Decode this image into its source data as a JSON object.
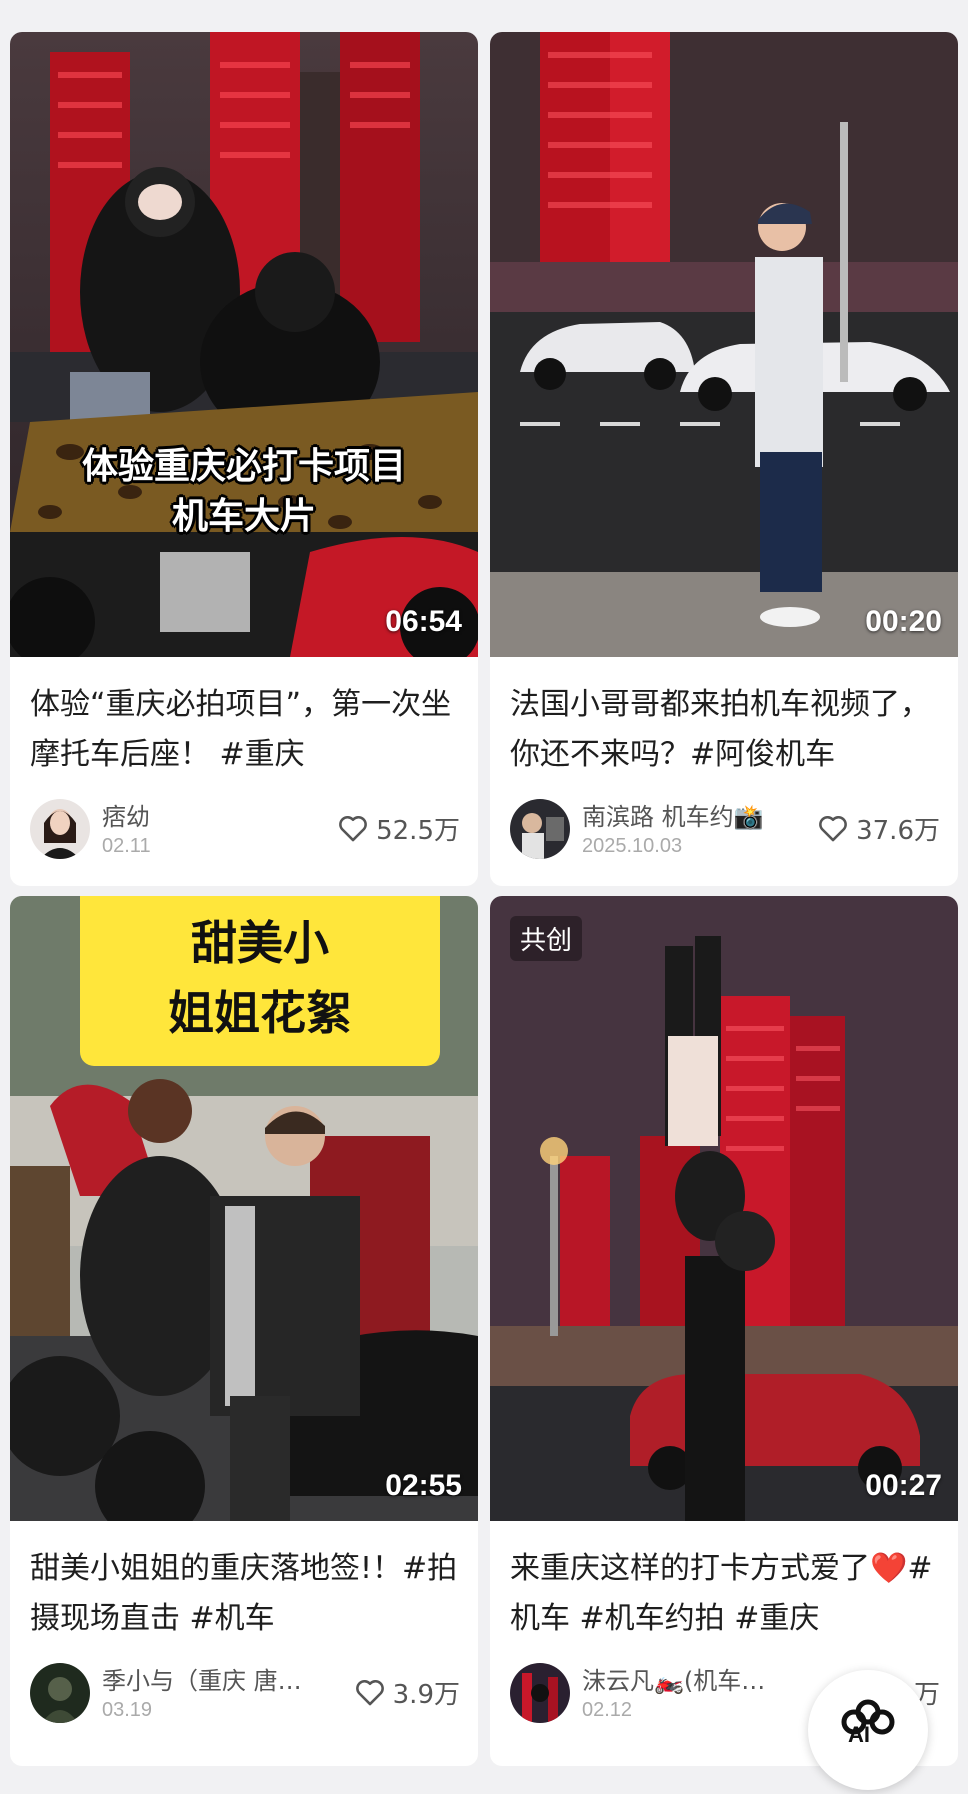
{
  "cards": [
    {
      "overlay_caption": [
        "体验重庆必打卡项目",
        "机车大片"
      ],
      "duration": "06:54",
      "title": "体验“重庆必拍项目”，第一次坐摩托车后座！ #重庆",
      "author": "痞幼",
      "date": "02.11",
      "likes": "52.5万"
    },
    {
      "duration": "00:20",
      "title": "法国小哥哥都来拍机车视频了，你还不来吗？#阿俊机车",
      "author": "南滨路 机车约📸",
      "date": "2025.10.03",
      "likes": "37.6万"
    },
    {
      "sign_text": [
        "甜美小",
        "姐姐花絮"
      ],
      "duration": "02:55",
      "title": "甜美小姐姐的重庆落地签!！#拍摄现场直击 #机车",
      "author": "季小与（重庆 唐…",
      "date": "03.19",
      "likes": "3.9万"
    },
    {
      "badge": "共创",
      "duration": "00:27",
      "title": "来重庆这样的打卡方式爱了❤️#机车 #机车约拍 #重庆",
      "author": "沫云凡🏍️(机车…",
      "date": "02.12",
      "likes": "万"
    }
  ],
  "ai_button": {
    "label": "AI",
    "icon": "ai-flower-icon"
  },
  "colors": {
    "background": "#f1f1f3",
    "card": "#ffffff",
    "neon_red": "#e8283c"
  }
}
